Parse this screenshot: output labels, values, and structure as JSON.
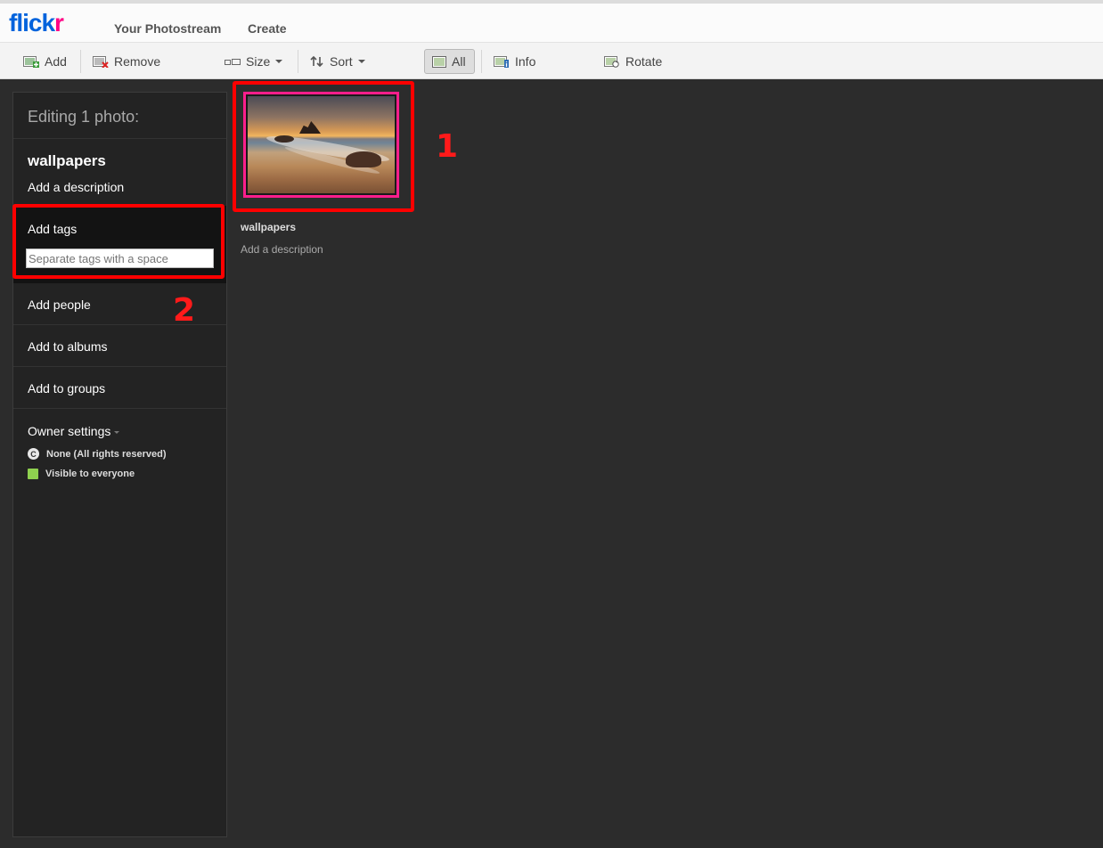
{
  "header": {
    "logo_blue": "flick",
    "logo_pink": "r",
    "nav": [
      "Your Photostream",
      "Create"
    ]
  },
  "toolbar": {
    "add": "Add",
    "remove": "Remove",
    "size": "Size",
    "sort": "Sort",
    "all": "All",
    "info": "Info",
    "rotate": "Rotate"
  },
  "sidebar": {
    "heading": "Editing 1 photo:",
    "photo_title": "wallpapers",
    "add_description": "Add a description",
    "tags_label": "Add tags",
    "tags_placeholder": "Separate tags with a space",
    "add_people": "Add people",
    "add_albums": "Add to albums",
    "add_groups": "Add to groups",
    "owner_settings": "Owner settings",
    "license": "None (All rights reserved)",
    "visibility": "Visible to everyone",
    "license_icon_letter": "C"
  },
  "photo": {
    "title": "wallpapers",
    "description": "Add a description"
  },
  "annotations": {
    "one": "1",
    "two": "2"
  },
  "colors": {
    "brand_blue": "#0063dc",
    "brand_pink": "#ff0084",
    "highlight_red": "#ff0000",
    "visible_green": "#8fd14f"
  }
}
